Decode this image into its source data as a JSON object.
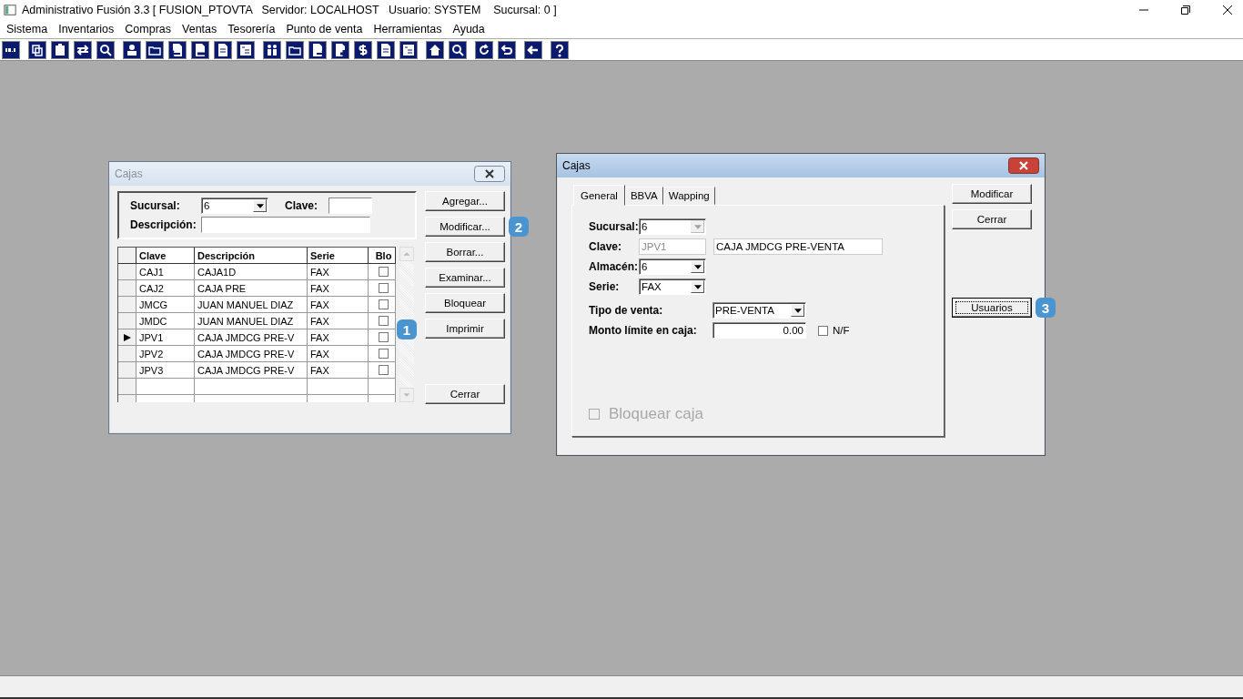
{
  "window": {
    "title": "Administrativo Fusión 3.3 [ FUSION_PTOVTA   Servidor: LOCALHOST   Usuario: SYSTEM    Sucursal: 0 ]"
  },
  "menu": [
    "Sistema",
    "Inventarios",
    "Compras",
    "Ventas",
    "Tesorería",
    "Punto de venta",
    "Herramientas",
    "Ayuda"
  ],
  "toolbar": [
    [
      {
        "kind": "calc"
      }
    ],
    [
      {
        "kind": "copy"
      },
      {
        "kind": "clipboard"
      },
      {
        "kind": "swap"
      },
      {
        "kind": "search"
      }
    ],
    [
      {
        "kind": "person"
      },
      {
        "kind": "folder"
      },
      {
        "kind": "doc-in"
      },
      {
        "kind": "doc-out"
      },
      {
        "kind": "doc"
      },
      {
        "kind": "list"
      }
    ],
    [
      {
        "kind": "people"
      },
      {
        "kind": "folder"
      },
      {
        "kind": "doc-arrow"
      },
      {
        "kind": "doc-plus"
      },
      {
        "kind": "dollar"
      },
      {
        "kind": "doc"
      },
      {
        "kind": "list"
      }
    ],
    [
      {
        "kind": "home"
      },
      {
        "kind": "search"
      }
    ],
    [
      {
        "kind": "redo"
      },
      {
        "kind": "undo"
      }
    ],
    [
      {
        "kind": "back"
      }
    ],
    [
      {
        "kind": "help"
      }
    ]
  ],
  "list_dialog": {
    "title": "Cajas",
    "active": false,
    "filter": {
      "sucursal_label": "Sucursal:",
      "sucursal_value": "6",
      "clave_label": "Clave:",
      "descripcion_label": "Descripción:"
    },
    "table": {
      "columns": [
        "Clave",
        "Descripción",
        "Serie",
        "Blo"
      ],
      "callout": "1",
      "rows": [
        {
          "clave": "CAJ1",
          "descripcion": "CAJA1D",
          "serie": "FAX",
          "blo": false,
          "current": false
        },
        {
          "clave": "CAJ2",
          "descripcion": "CAJA PRE",
          "serie": "FAX",
          "blo": false,
          "current": false
        },
        {
          "clave": "JMCG",
          "descripcion": "JUAN MANUEL DIAZ",
          "serie": "FAX",
          "blo": false,
          "current": false
        },
        {
          "clave": "JMDC",
          "descripcion": "JUAN MANUEL DIAZ",
          "serie": "FAX",
          "blo": false,
          "current": false
        },
        {
          "clave": "JPV1",
          "descripcion": "CAJA JMDCG PRE-V",
          "serie": "FAX",
          "blo": false,
          "current": true
        },
        {
          "clave": "JPV2",
          "descripcion": "CAJA JMDCG PRE-V",
          "serie": "FAX",
          "blo": false,
          "current": false
        },
        {
          "clave": "JPV3",
          "descripcion": "CAJA JMDCG PRE-V",
          "serie": "FAX",
          "blo": false,
          "current": false
        }
      ]
    },
    "buttons": [
      {
        "label": "Agregar..."
      },
      {
        "label": "Modificar...",
        "callout": "2"
      },
      {
        "label": "Borrar..."
      },
      {
        "label": "Examinar..."
      },
      {
        "label": "Bloquear"
      },
      {
        "label": "Imprimir"
      }
    ],
    "close_button": "Cerrar"
  },
  "detail_dialog": {
    "title": "Cajas",
    "active": true,
    "tabs": [
      {
        "label": "General",
        "selected": true
      },
      {
        "label": "BBVA",
        "selected": false
      },
      {
        "label": "Wapping",
        "selected": false
      }
    ],
    "sucursal": {
      "label": "Sucursal:",
      "value": "6",
      "disabled": true
    },
    "clave": {
      "label": "Clave:",
      "value": "JPV1",
      "disabled": true,
      "description": "CAJA JMDCG PRE-VENTA"
    },
    "almacen": {
      "label": "Almacén:",
      "value": "6",
      "disabled": false
    },
    "serie": {
      "label": "Serie:",
      "value": "FAX",
      "disabled": false
    },
    "tipo_venta": {
      "label": "Tipo de venta:",
      "value": "PRE-VENTA",
      "disabled": false
    },
    "monto": {
      "label": "Monto límite en caja:",
      "value": "0.00",
      "nf_label": "N/F",
      "nf_checked": false
    },
    "bloquear": {
      "label": "Bloquear caja",
      "checked": false,
      "disabled": true
    },
    "buttons": [
      {
        "label": "Modificar"
      },
      {
        "label": "Cerrar"
      }
    ],
    "usuarios_button": {
      "label": "Usuarios",
      "callout": "3",
      "focused": true
    }
  }
}
